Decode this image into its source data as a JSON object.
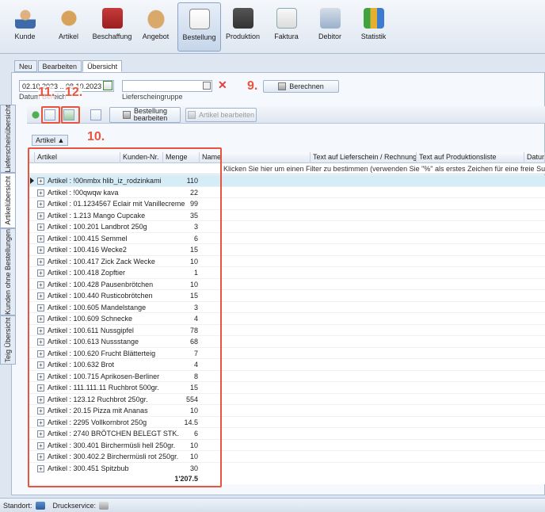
{
  "ribbon": {
    "items": [
      {
        "label": "Kunde",
        "icon": "customer-icon"
      },
      {
        "label": "Artikel",
        "icon": "bread-icon"
      },
      {
        "label": "Beschaffung",
        "icon": "basket-icon"
      },
      {
        "label": "Angebot",
        "icon": "handshake-icon"
      },
      {
        "label": "Bestellung",
        "icon": "order-document-icon",
        "active": true
      },
      {
        "label": "Produktion",
        "icon": "oven-icon"
      },
      {
        "label": "Faktura",
        "icon": "invoice-icon"
      },
      {
        "label": "Debitor",
        "icon": "debtor-icon"
      },
      {
        "label": "Statistik",
        "icon": "chart-icon"
      }
    ]
  },
  "tabs": [
    "Neu",
    "Bearbeiten",
    "Übersicht"
  ],
  "filters": {
    "date_range": "02.10.2023 .. 08.10.2023",
    "date_label": "Datum Bereich",
    "lieferscheingruppe_label": "Lieferscheingruppe",
    "berechnen_label": "Berechnen"
  },
  "callouts": {
    "c9": "9.",
    "c10": "10.",
    "c11": "11.",
    "c12": "12."
  },
  "vertical_tabs": [
    "Lieferscheinübersicht",
    "Artikelübersicht",
    "Kunden ohne Bestellungen",
    "Teig Übersicht"
  ],
  "toolbar": {
    "bestellung_bearbeiten": "Bestellung bearbeiten",
    "bestellung_bearbeiten_line1": "Bestellung",
    "bestellung_bearbeiten_line2": "bearbeiten",
    "artikel_bearbeiten": "Artikel bearbeiten"
  },
  "groupby": "Artikel ▲",
  "grid": {
    "columns": [
      "Artikel",
      "Kunden-Nr.",
      "Menge",
      "Name",
      "Text auf Lieferschein / Rechnung",
      "Text auf Produktionsliste",
      "Datum"
    ],
    "filter_hint": "Klicken Sie hier um einen Filter zu bestimmen (verwenden Sie \"%\" als erstes Zeichen für eine freie Suche)",
    "rows": [
      {
        "label": "Artikel : !00nmbx hlib_iz_rodzinkami",
        "qty": "110"
      },
      {
        "label": "Artikel : !00qwqw kava",
        "qty": "22"
      },
      {
        "label": "Artikel : 01.1234567 Eclair mit Vanillecreme",
        "qty": "99"
      },
      {
        "label": "Artikel : 1.213 Mango Cupcake",
        "qty": "35"
      },
      {
        "label": "Artikel : 100.201 Landbrot 250g",
        "qty": "3"
      },
      {
        "label": "Artikel : 100.415 Semmel",
        "qty": "6"
      },
      {
        "label": "Artikel : 100.416 Wecke2",
        "qty": "15"
      },
      {
        "label": "Artikel : 100.417 Zick Zack Wecke",
        "qty": "10"
      },
      {
        "label": "Artikel : 100.418 Zopftier",
        "qty": "1"
      },
      {
        "label": "Artikel : 100.428 Pausenbrötchen",
        "qty": "10"
      },
      {
        "label": "Artikel : 100.440 Rusticobrötchen",
        "qty": "15"
      },
      {
        "label": "Artikel : 100.605 Mandelstange",
        "qty": "3"
      },
      {
        "label": "Artikel : 100.609 Schnecke",
        "qty": "4"
      },
      {
        "label": "Artikel : 100.611 Nussgipfel",
        "qty": "78"
      },
      {
        "label": "Artikel : 100.613 Nussstange",
        "qty": "68"
      },
      {
        "label": "Artikel : 100.620 Frucht Blätterteig",
        "qty": "7"
      },
      {
        "label": "Artikel : 100.632  Brot",
        "qty": "4"
      },
      {
        "label": "Artikel : 100.715 Aprikosen-Berliner",
        "qty": "8"
      },
      {
        "label": "Artikel : 111.111.11 Ruchbrot 500gr.",
        "qty": "15"
      },
      {
        "label": "Artikel : 123.12 Ruchbrot 250gr.",
        "qty": "554"
      },
      {
        "label": "Artikel : 20.15 Pizza mit Ananas",
        "qty": "10"
      },
      {
        "label": "Artikel : 2295 Vollkornbrot 250g",
        "qty": "14.5"
      },
      {
        "label": "Artikel : 2740 BRÖTCHEN BELEGT STK.",
        "qty": "6"
      },
      {
        "label": "Artikel : 300.401 Birchermüsli hell 250gr.",
        "qty": "10"
      },
      {
        "label": "Artikel : 300.402.2 Birchermüsli rot 250gr.",
        "qty": "10"
      },
      {
        "label": "Artikel : 300.451 Spitzbub",
        "qty": "30"
      }
    ],
    "total": "1'207.5"
  },
  "status": {
    "standort": "Standort:",
    "druckservice": "Druckservice:"
  },
  "colors": {
    "callout": "#e8553e",
    "selected_row": "#d6edf8"
  }
}
